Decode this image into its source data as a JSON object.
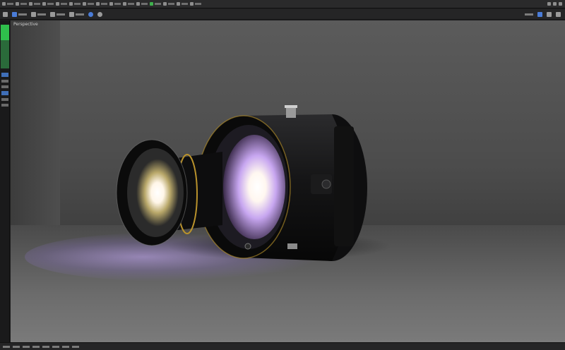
{
  "viewport": {
    "label": "Perspective",
    "scene": "camera-lens-render"
  },
  "menubar": {
    "items": [
      "menu-1",
      "menu-2",
      "menu-3",
      "menu-4",
      "menu-5",
      "menu-6",
      "menu-7",
      "menu-8",
      "menu-9",
      "menu-10",
      "menu-11",
      "menu-12",
      "menu-13",
      "menu-14",
      "menu-15",
      "menu-16",
      "menu-17",
      "menu-18",
      "menu-19",
      "menu-20",
      "menu-21"
    ],
    "green_index": 12
  },
  "colors": {
    "accent_green": "#2fbf4c",
    "accent_blue": "#4a7cd8",
    "lens_purple": "#b89cff",
    "brass": "#b9922c"
  }
}
